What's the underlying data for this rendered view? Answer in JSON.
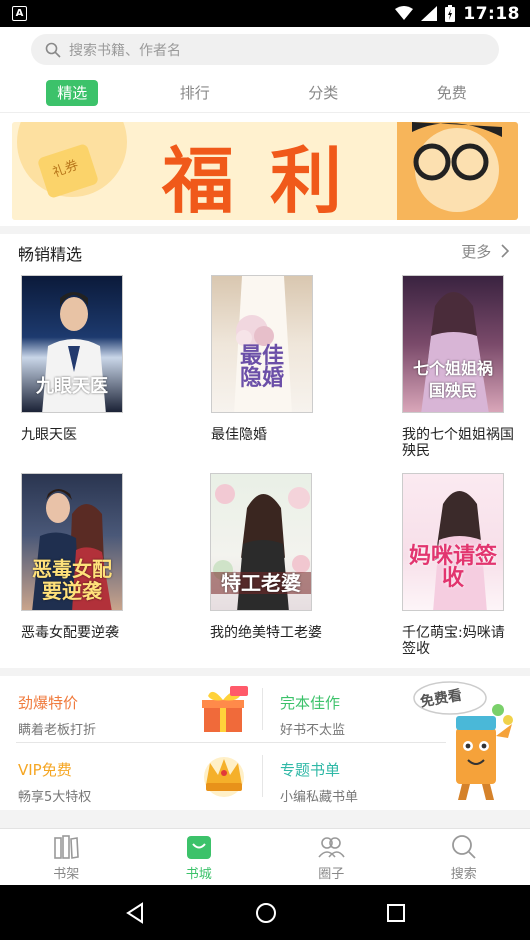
{
  "status": {
    "time": "17:18",
    "left_icon": "A"
  },
  "search": {
    "placeholder": "搜索书籍、作者名"
  },
  "tabs": [
    {
      "label": "精选",
      "active": true
    },
    {
      "label": "排行",
      "active": false
    },
    {
      "label": "分类",
      "active": false
    },
    {
      "label": "免费",
      "active": false
    }
  ],
  "banner": {
    "text": "福利",
    "tag": "礼券"
  },
  "section": {
    "title": "畅销精选",
    "more": "更多"
  },
  "books": [
    {
      "title": "九眼天医",
      "cover_text": "九眼天医"
    },
    {
      "title": "最佳隐婚",
      "cover_text": "最佳隐婚"
    },
    {
      "title": "我的七个姐姐祸国殃民",
      "cover_text": "七个姐姐祸国殃民"
    },
    {
      "title": "恶毒女配要逆袭",
      "cover_text": "恶毒女配要逆袭"
    },
    {
      "title": "我的绝美特工老婆",
      "cover_text": "特工老婆"
    },
    {
      "title": "千亿萌宝:妈咪请签收",
      "cover_text": "妈咪请签收"
    }
  ],
  "promos": [
    {
      "title": "劲爆特价",
      "subtitle": "瞒着老板打折",
      "color": "#f07a3c"
    },
    {
      "title": "完本佳作",
      "subtitle": "好书不太监",
      "color": "#3cc26a"
    },
    {
      "title": "VIP免费",
      "subtitle": "畅享5大特权",
      "color": "#f5a623"
    },
    {
      "title": "专题书单",
      "subtitle": "小编私藏书单",
      "color": "#2fb8a6"
    }
  ],
  "free_badge": "免费看",
  "bottom_nav": [
    {
      "label": "书架",
      "icon": "bookshelf-icon",
      "active": false
    },
    {
      "label": "书城",
      "icon": "store-icon",
      "active": true
    },
    {
      "label": "圈子",
      "icon": "community-icon",
      "active": false
    },
    {
      "label": "搜索",
      "icon": "search-icon",
      "active": false
    }
  ],
  "colors": {
    "accent": "#3cc26a"
  }
}
